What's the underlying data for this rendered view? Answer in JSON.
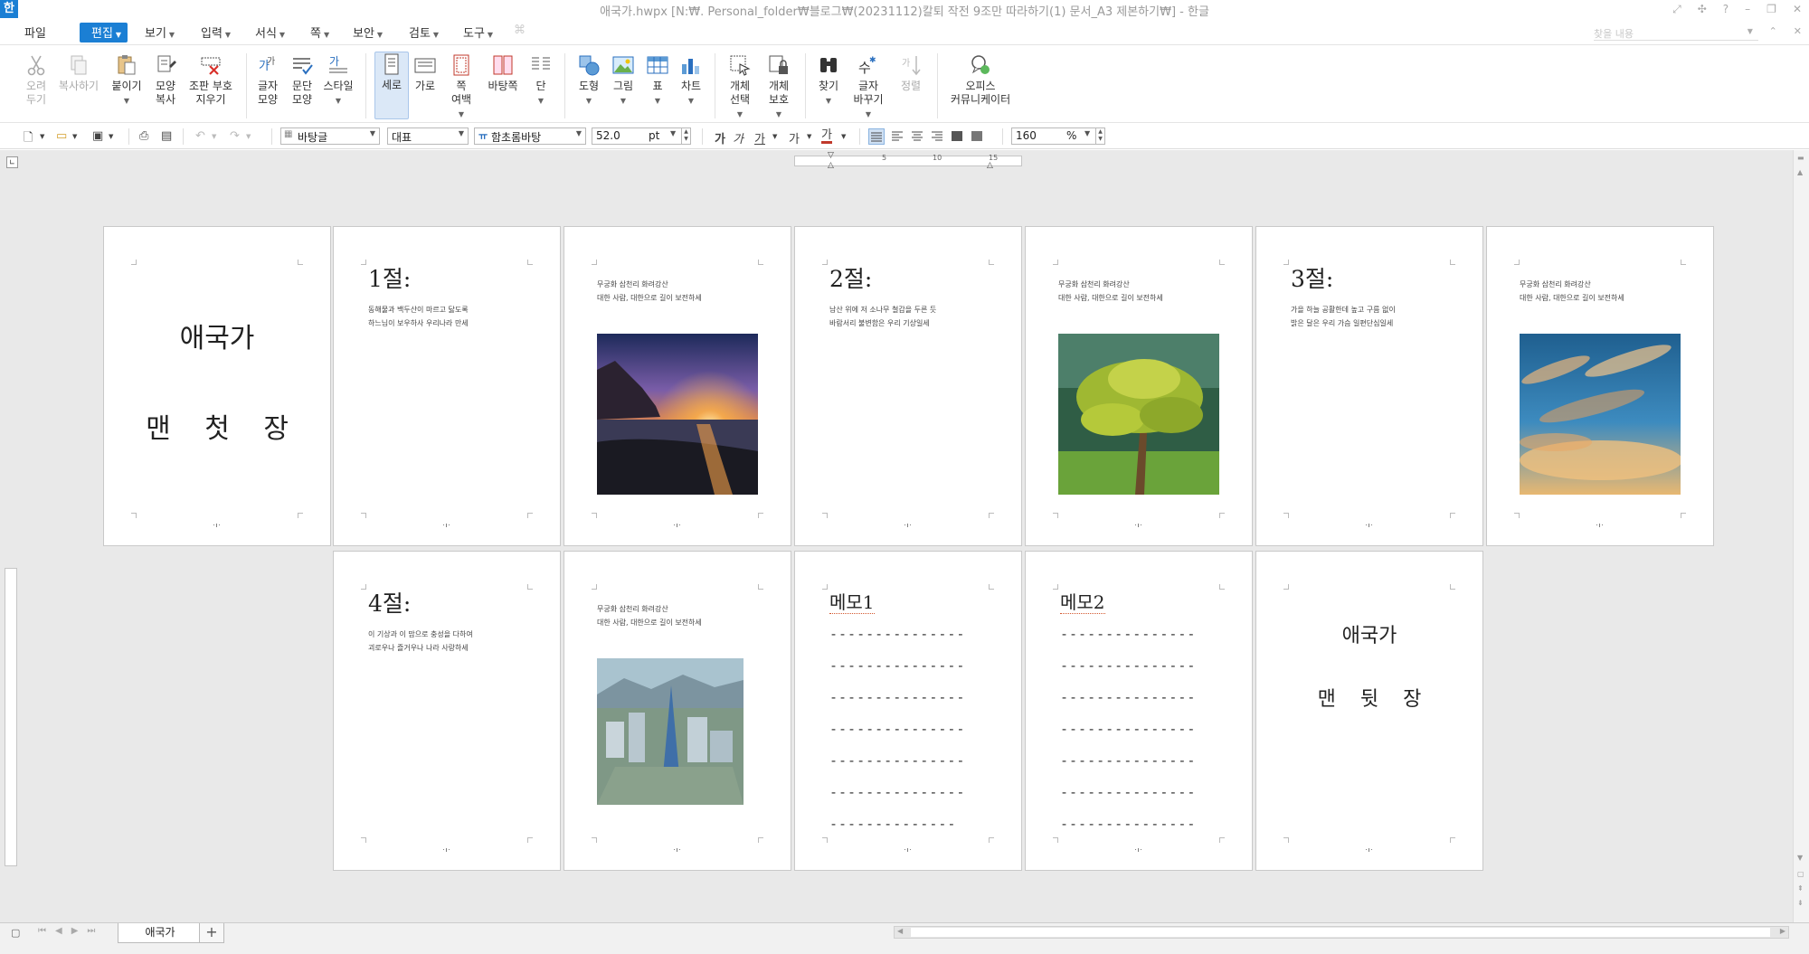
{
  "window": {
    "app_icon": "한",
    "title": "애국가.hwpx [N:₩. Personal_folder₩블로그₩(20231112)칼퇴 작전 9조만 따라하기(1) 문서_A3 제본하기₩] - 한글"
  },
  "menu": {
    "items": [
      {
        "label": "파일",
        "caret": false,
        "active": false
      },
      {
        "label": "편집",
        "caret": true,
        "active": true
      },
      {
        "label": "보기",
        "caret": true,
        "active": false
      },
      {
        "label": "입력",
        "caret": true,
        "active": false
      },
      {
        "label": "서식",
        "caret": true,
        "active": false
      },
      {
        "label": "쪽",
        "caret": true,
        "active": false
      },
      {
        "label": "보안",
        "caret": true,
        "active": false
      },
      {
        "label": "검토",
        "caret": true,
        "active": false
      },
      {
        "label": "도구",
        "caret": true,
        "active": false
      }
    ],
    "search_placeholder": "찾을 내용"
  },
  "ribbon": {
    "buttons": [
      {
        "id": "cut",
        "label": "오려\n두기",
        "icon": "scissors-icon",
        "disabled": true
      },
      {
        "id": "copy",
        "label": "복사하기",
        "icon": "copy-icon",
        "disabled": true
      },
      {
        "id": "paste",
        "label": "붙이기",
        "icon": "paste-icon",
        "caret": true
      },
      {
        "id": "format-copy",
        "label": "모양\n복사",
        "icon": "format-painter-icon"
      },
      {
        "id": "clear-marks",
        "label": "조판 부호\n지우기",
        "icon": "clear-marks-icon"
      },
      {
        "id": "char-shape",
        "label": "글자\n모양",
        "icon": "char-shape-icon"
      },
      {
        "id": "para-shape",
        "label": "문단\n모양",
        "icon": "para-shape-icon"
      },
      {
        "id": "style",
        "label": "스타일",
        "icon": "style-icon",
        "caret": true
      },
      {
        "id": "portrait",
        "label": "세로",
        "icon": "portrait-icon",
        "selected": true
      },
      {
        "id": "landscape",
        "label": "가로",
        "icon": "landscape-icon"
      },
      {
        "id": "margins",
        "label": "쪽\n여백",
        "icon": "margins-icon",
        "caret": true
      },
      {
        "id": "master-page",
        "label": "바탕쪽",
        "icon": "master-page-icon"
      },
      {
        "id": "columns",
        "label": "단",
        "icon": "columns-icon",
        "caret": true
      },
      {
        "id": "shape",
        "label": "도형",
        "icon": "shape-icon",
        "caret": true
      },
      {
        "id": "picture",
        "label": "그림",
        "icon": "picture-icon",
        "caret": true
      },
      {
        "id": "table",
        "label": "표",
        "icon": "table-icon",
        "caret": true
      },
      {
        "id": "chart",
        "label": "차트",
        "icon": "chart-icon",
        "caret": true
      },
      {
        "id": "obj-select",
        "label": "개체\n선택",
        "icon": "object-select-icon",
        "caret": true
      },
      {
        "id": "obj-protect",
        "label": "개체\n보호",
        "icon": "object-protect-icon",
        "caret": true
      },
      {
        "id": "find",
        "label": "찾기",
        "icon": "binoculars-icon",
        "caret": true
      },
      {
        "id": "replace",
        "label": "글자\n바꾸기",
        "icon": "replace-icon",
        "caret": true
      },
      {
        "id": "sort",
        "label": "정렬",
        "icon": "sort-icon",
        "disabled": true
      },
      {
        "id": "office-communicator",
        "label": "오피스\n커뮤니케이터",
        "icon": "communicator-icon"
      }
    ]
  },
  "format": {
    "style": "바탕글",
    "lang": "대표",
    "font": "함초롬바탕",
    "size": "52.0",
    "unit": "pt",
    "bold": "가",
    "italic": "가",
    "underline": "가",
    "strike": "가",
    "color_char": "가",
    "zoom": "160",
    "zoom_unit": "%",
    "font_icon_glyph": "ㅠ"
  },
  "ruler": {
    "marks": [
      "5",
      "10",
      "15"
    ]
  },
  "pages": {
    "cover": {
      "title": "애국가",
      "subtitle": "맨 첫 장"
    },
    "sec1": {
      "heading": "1절:",
      "lines": [
        "동해물과 백두산이 마르고 닳도록",
        "하느님이 보우하사 우리나라 만세"
      ]
    },
    "caption": {
      "lines": [
        "무궁화 삼천리 화려강산",
        "대한 사람, 대한으로 길이 보전하세"
      ]
    },
    "sec2": {
      "heading": "2절:",
      "lines": [
        "남산 위에 저 소나무 철갑을 두른 듯",
        "바람서리 불변함은 우리 기상일세"
      ]
    },
    "sec3": {
      "heading": "3절:",
      "lines": [
        "가을 하늘 공활한데 높고 구름 없이",
        "밝은 달은 우리 가슴 일편단심일세"
      ]
    },
    "sec4": {
      "heading": "4절:",
      "lines": [
        "이 기상과 이 맘으로 충성을 다하여",
        "괴로우나 즐거우나 나라 사랑하세"
      ]
    },
    "memo1": {
      "heading": "메모1",
      "dashes": [
        "---------------",
        "---------------",
        "---------------",
        "---------------",
        "---------------",
        "---------------",
        "--------------"
      ]
    },
    "memo2": {
      "heading": "메모2",
      "dashes": [
        "---------------",
        "---------------",
        "---------------",
        "---------------",
        "---------------",
        "---------------",
        "---------------"
      ]
    },
    "back": {
      "title": "애국가",
      "subtitle": "맨 뒷 장"
    },
    "page_number_mark": "·ı·"
  },
  "bottom": {
    "sheet_tab": "애국가",
    "add_tab": "+"
  }
}
